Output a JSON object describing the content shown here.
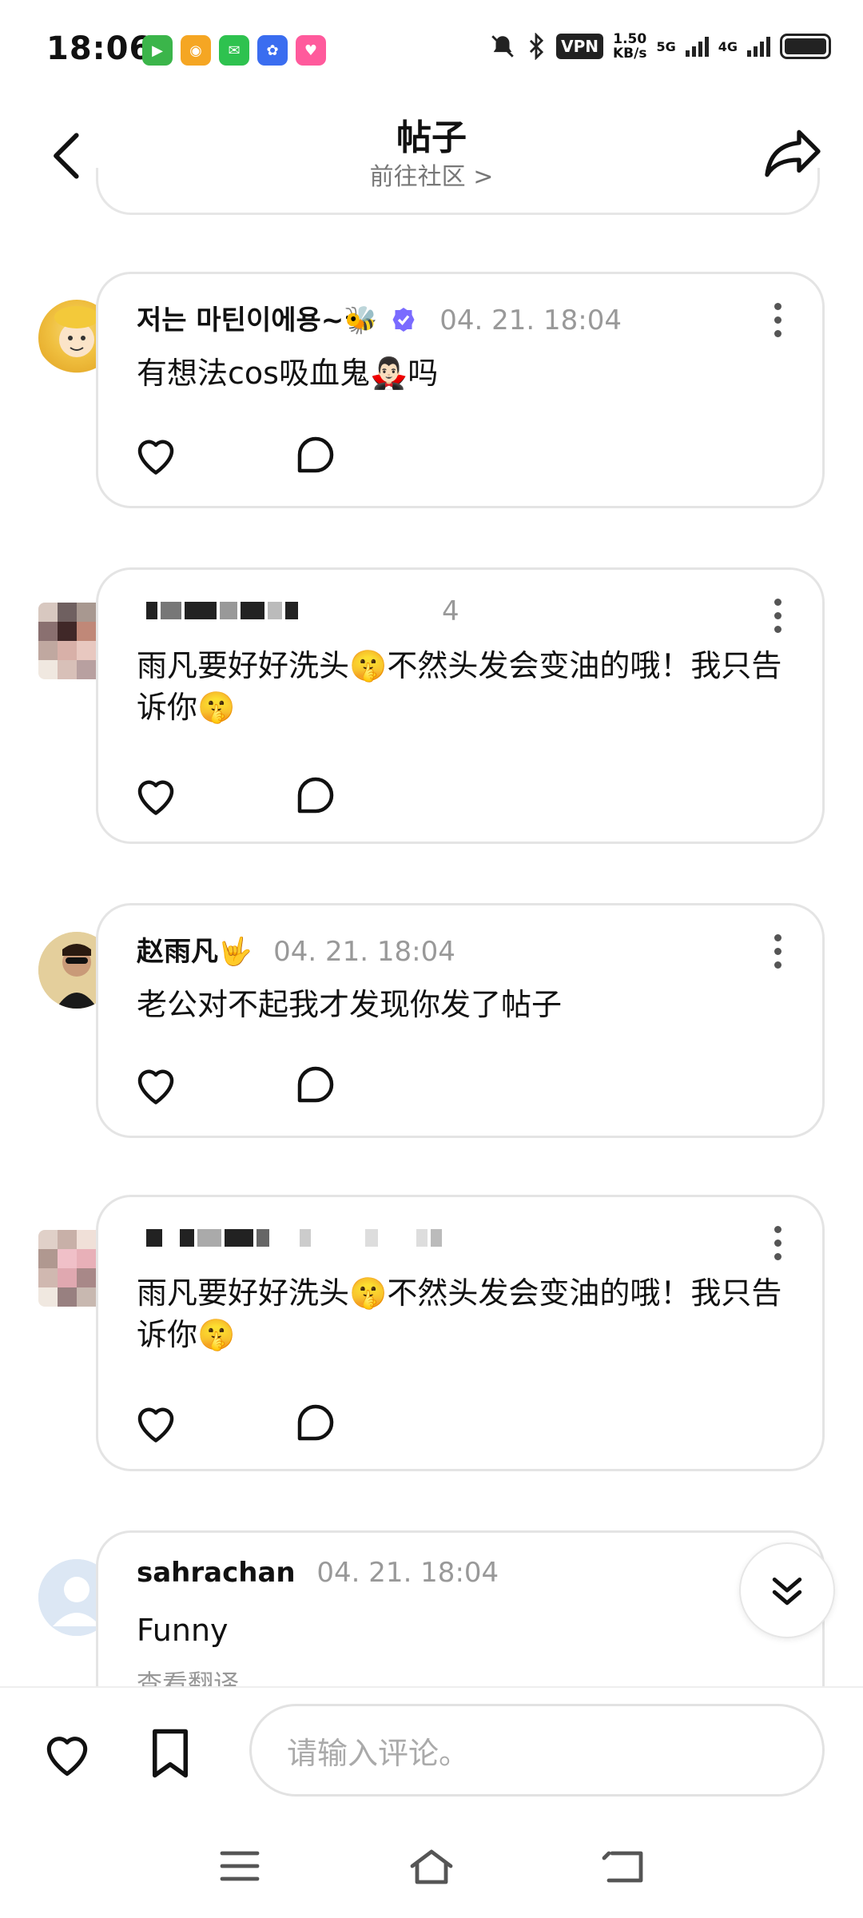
{
  "status": {
    "time": "18:06",
    "vpn": "VPN",
    "speed_value": "1.50",
    "speed_unit": "KB/s",
    "net1": "5G",
    "net2": "4G"
  },
  "header": {
    "title": "帖子",
    "subtitle": "前往社区 >"
  },
  "comments": [
    {
      "username": "저는 마틴이에용~🐝",
      "time": "04. 21. 18:04",
      "text": "有想法cos吸血鬼🧛🏻‍♂️吗",
      "avatar": "bee-costume-child"
    },
    {
      "username": "",
      "time": "4",
      "text": "雨凡要好好洗头🤫不然头发会变油的哦！我只告诉你🤫",
      "avatar": "pixelated"
    },
    {
      "username": "赵雨凡🤟",
      "time": "04. 21. 18:04",
      "text": "老公对不起我才发现你发了帖子",
      "avatar": "sunglasses-person"
    },
    {
      "username": "",
      "time": "",
      "text": "雨凡要好好洗头🤫不然头发会变油的哦！我只告诉你🤫",
      "avatar": "pixelated"
    },
    {
      "username": "sahrachan",
      "time": "04. 21. 18:04",
      "text": "Funny",
      "extra": "查看翻译",
      "avatar": "default-user"
    }
  ],
  "bottom": {
    "input_placeholder": "请输入评论。"
  },
  "colors": {
    "border": "#e4e4e4",
    "muted": "#999999",
    "verified": "#6b5cff"
  }
}
